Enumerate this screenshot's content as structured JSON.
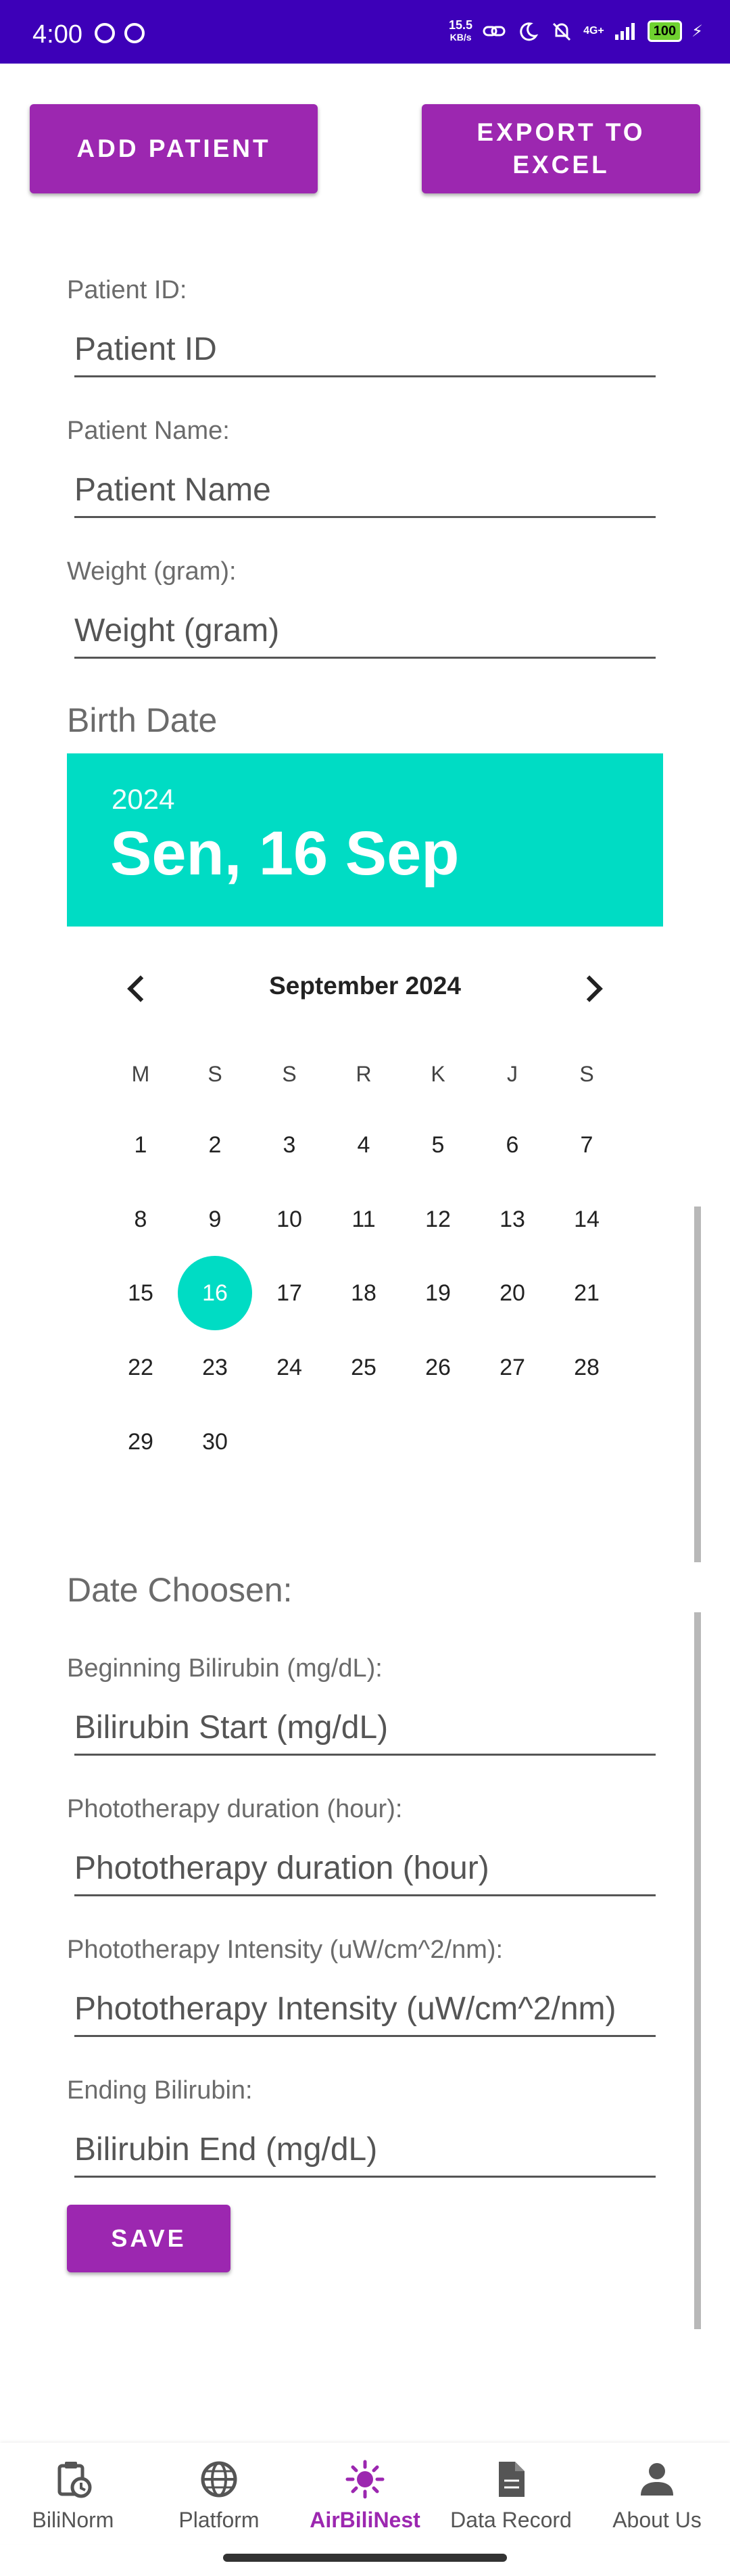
{
  "status_bar": {
    "time": "4:00",
    "speed_value": "15.5",
    "speed_unit": "KB/s",
    "network": "4G+",
    "battery": "100"
  },
  "actions": {
    "add_patient": "ADD PATIENT",
    "export_excel": "EXPORT TO EXCEL"
  },
  "form": {
    "patient_id": {
      "label": "Patient ID:",
      "placeholder": "Patient ID"
    },
    "patient_name": {
      "label": "Patient Name:",
      "placeholder": "Patient Name"
    },
    "weight": {
      "label": "Weight (gram):",
      "placeholder": "Weight (gram)"
    },
    "birth_date_title": "Birth Date",
    "date_chosen_title": "Date Choosen:",
    "bili_start": {
      "label": "Beginning Bilirubin (mg/dL):",
      "placeholder": "Bilirubin Start (mg/dL)"
    },
    "photo_duration": {
      "label": "Phototherapy duration (hour):",
      "placeholder": "Phototherapy duration (hour)"
    },
    "photo_intensity": {
      "label": "Phototherapy Intensity (uW/cm^2/nm):",
      "placeholder": "Phototherapy Intensity (uW/cm^2/nm)"
    },
    "bili_end": {
      "label": "Ending Bilirubin:",
      "placeholder": "Bilirubin End (mg/dL)"
    },
    "save": "SAVE"
  },
  "datepicker": {
    "year": "2024",
    "selected_label": "Sen, 16 Sep",
    "month_label": "September 2024",
    "weekdays": [
      "M",
      "S",
      "S",
      "R",
      "K",
      "J",
      "S"
    ],
    "days": [
      "1",
      "2",
      "3",
      "4",
      "5",
      "6",
      "7",
      "8",
      "9",
      "10",
      "11",
      "12",
      "13",
      "14",
      "15",
      "16",
      "17",
      "18",
      "19",
      "20",
      "21",
      "22",
      "23",
      "24",
      "25",
      "26",
      "27",
      "28",
      "29",
      "30"
    ],
    "selected_day": "16",
    "accent": "#00dcc4"
  },
  "bottom_nav": [
    {
      "label": "BiliNorm",
      "icon": "clipboard-clock-icon"
    },
    {
      "label": "Platform",
      "icon": "globe-icon"
    },
    {
      "label": "AirBiliNest",
      "icon": "sun-icon",
      "active": true
    },
    {
      "label": "Data Record",
      "icon": "document-icon"
    },
    {
      "label": "About Us",
      "icon": "person-icon"
    }
  ],
  "colors": {
    "primary": "#9c27b0",
    "status_bar": "#3d00b8",
    "picker_header": "#00dcc4"
  }
}
